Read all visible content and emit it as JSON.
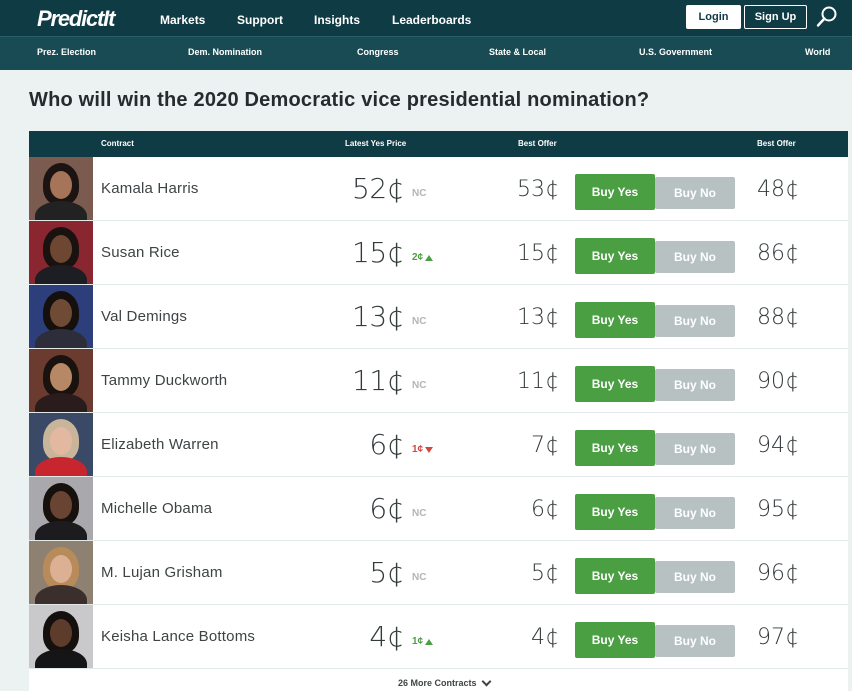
{
  "header": {
    "logo_text": "PredictIt",
    "nav": [
      "Markets",
      "Support",
      "Insights",
      "Leaderboards"
    ],
    "login_label": "Login",
    "signup_label": "Sign Up"
  },
  "subnav": [
    "Prez. Election",
    "Dem. Nomination",
    "Congress",
    "State & Local",
    "U.S. Government",
    "World"
  ],
  "page_title": "Who will win the 2020 Democratic vice presidential nomination?",
  "table": {
    "headers": {
      "contract": "Contract",
      "latest_yes": "Latest Yes Price",
      "best_offer_yes": "Best Offer",
      "best_offer_no": "Best Offer"
    },
    "buy_yes_label": "Buy Yes",
    "buy_no_label": "Buy No",
    "rows": [
      {
        "name": "Kamala Harris",
        "price": "52¢",
        "change": "NC",
        "change_dir": "nc",
        "best_yes": "53¢",
        "best_no": "48¢",
        "photo_colors": {
          "bg": "#7b5a4f",
          "hair": "#1c1412",
          "face": "#a67458",
          "body": "#222"
        }
      },
      {
        "name": "Susan Rice",
        "price": "15¢",
        "change": "2¢",
        "change_dir": "up",
        "best_yes": "15¢",
        "best_no": "86¢",
        "photo_colors": {
          "bg": "#8a2630",
          "hair": "#1a1210",
          "face": "#6e4733",
          "body": "#1d1d24"
        }
      },
      {
        "name": "Val Demings",
        "price": "13¢",
        "change": "NC",
        "change_dir": "nc",
        "best_yes": "13¢",
        "best_no": "88¢",
        "photo_colors": {
          "bg": "#2c3f7a",
          "hair": "#15100d",
          "face": "#6f4a35",
          "body": "#2d2e3a"
        }
      },
      {
        "name": "Tammy Duckworth",
        "price": "11¢",
        "change": "NC",
        "change_dir": "nc",
        "best_yes": "11¢",
        "best_no": "90¢",
        "photo_colors": {
          "bg": "#6b3b2f",
          "hair": "#1a120e",
          "face": "#b78865",
          "body": "#2a1c1c"
        }
      },
      {
        "name": "Elizabeth Warren",
        "price": "6¢",
        "change": "1¢",
        "change_dir": "down",
        "best_yes": "7¢",
        "best_no": "94¢",
        "photo_colors": {
          "bg": "#3a4a66",
          "hair": "#c8b59a",
          "face": "#e2b9a0",
          "body": "#c7262e"
        }
      },
      {
        "name": "Michelle Obama",
        "price": "6¢",
        "change": "NC",
        "change_dir": "nc",
        "best_yes": "6¢",
        "best_no": "95¢",
        "photo_colors": {
          "bg": "#a9a9ad",
          "hair": "#17110d",
          "face": "#6a4432",
          "body": "#1c1c1f"
        }
      },
      {
        "name": "M. Lujan Grisham",
        "price": "5¢",
        "change": "NC",
        "change_dir": "nc",
        "best_yes": "5¢",
        "best_no": "96¢",
        "photo_colors": {
          "bg": "#8f8172",
          "hair": "#b78c5a",
          "face": "#dcb093",
          "body": "#3a2f2c"
        }
      },
      {
        "name": "Keisha Lance Bottoms",
        "price": "4¢",
        "change": "1¢",
        "change_dir": "up",
        "best_yes": "4¢",
        "best_no": "97¢",
        "photo_colors": {
          "bg": "#c9c9cc",
          "hair": "#15100d",
          "face": "#5e3c2b",
          "body": "#151517"
        }
      }
    ]
  },
  "more_contracts": "26 More Contracts",
  "colors": {
    "header": "#0f3b44",
    "subnav": "#184b54",
    "buy_yes": "#4a9f42",
    "buy_no": "#b7c1c2",
    "up": "#4a9f42",
    "down": "#d3463f"
  }
}
